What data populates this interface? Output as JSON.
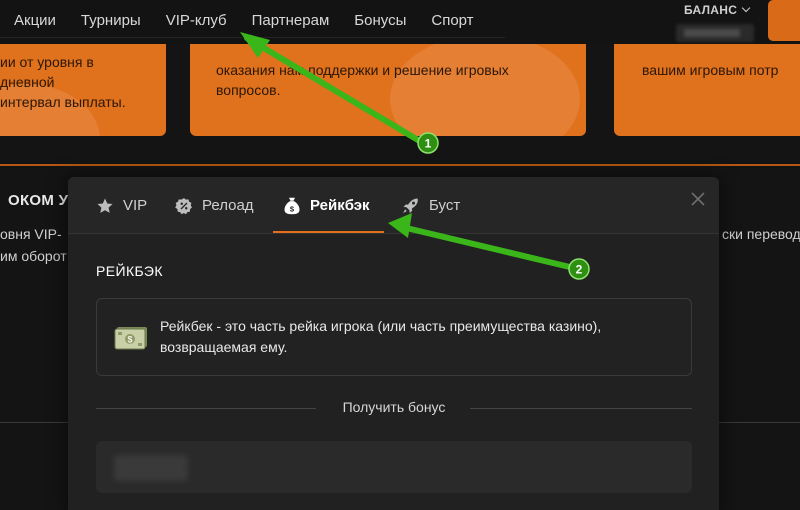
{
  "nav": {
    "items": [
      "Акции",
      "Турниры",
      "VIP-клуб",
      "Партнерам",
      "Бонусы",
      "Спорт"
    ],
    "balance_label": "БАЛАНС"
  },
  "background": {
    "card1_lines": [
      "ии от уровня в",
      "дневной",
      "интервал выплаты."
    ],
    "card2_lines": [
      "оказания нам поддержки и решение игровых",
      "вопросов."
    ],
    "card3_lines": [
      "вашим игровым потр"
    ],
    "heading": "ОКОМ УР",
    "left_lines": [
      "овня VIP-",
      "им оборот"
    ],
    "right_line": "ски перевод"
  },
  "modal": {
    "tabs": [
      {
        "label": "VIP",
        "icon": "star-icon"
      },
      {
        "label": "Релоад",
        "icon": "percent-badge-icon"
      },
      {
        "label": "Рейкбэк",
        "icon": "money-bag-icon"
      },
      {
        "label": "Буст",
        "icon": "rocket-icon"
      }
    ],
    "active_tab": "Рейкбэк",
    "section_title": "РЕЙКБЭК",
    "info_text": "Рейкбек - это часть рейка игрока (или часть преимущества казино), возвращаемая ему.",
    "divider_label": "Получить бонус"
  },
  "annotations": {
    "markers": [
      "1",
      "2"
    ],
    "arrow_color": "#3bb61a"
  },
  "colors": {
    "accent": "#e36f1a",
    "card_orange": "#e0711d",
    "modal_bg": "#212121"
  }
}
